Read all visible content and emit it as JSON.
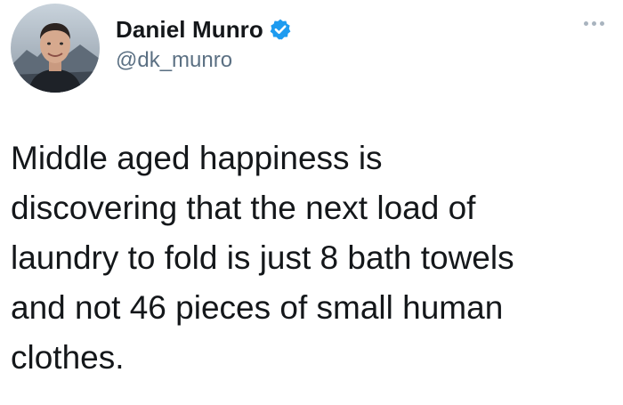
{
  "author": {
    "display_name": "Daniel Munro",
    "handle": "@dk_munro",
    "verified": true,
    "avatar_icon": "profile-photo"
  },
  "tweet": {
    "text": "Middle aged happiness is\ndiscovering that the next load of\nlaundry to fold is just 8 bath towels\nand not 46 pieces of small human\nclothes."
  },
  "icons": {
    "verified": "verified-badge-icon",
    "more": "more-options-icon"
  },
  "colors": {
    "verified_blue": "#1d9bf0",
    "handle_gray": "#5b7083",
    "text": "#14171a"
  }
}
